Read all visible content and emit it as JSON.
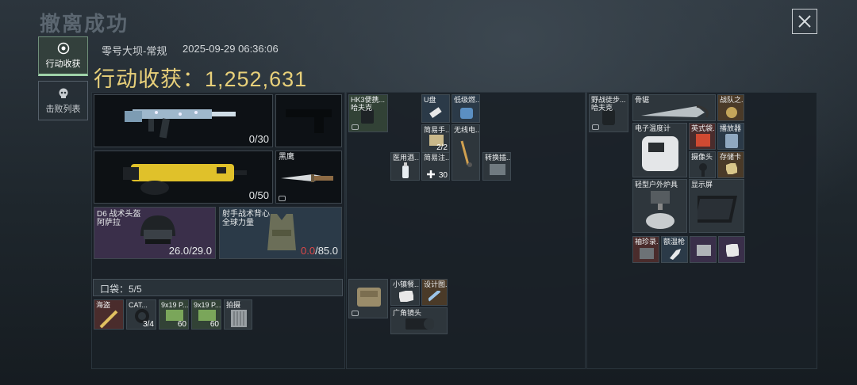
{
  "header": {
    "title": "撤离成功",
    "map": "零号大坝-常规",
    "datetime": "2025-09-29 06:36:06",
    "harvest_label": "行动收获：",
    "harvest_value": "1,252,631"
  },
  "sidebar": {
    "items": [
      {
        "label": "行动收获"
      },
      {
        "label": "击败列表"
      }
    ]
  },
  "loadout": {
    "weapon1": {
      "ammo": "0/30"
    },
    "weapon2": {
      "ammo": "0/50"
    },
    "melee": {
      "label": "黑鹰"
    },
    "helmet": {
      "name": "D6 战术头盔",
      "sub": "阿萨拉",
      "durability": "26.0/29.0"
    },
    "armor": {
      "name": "射手战术背心",
      "sub": "全球力量",
      "durability_current": "0.0",
      "durability_max": "/85.0"
    },
    "pocket_label": "口袋：5/5"
  },
  "pocket_items": [
    {
      "name": "海盗",
      "count": ""
    },
    {
      "name": "CAT...",
      "count": "3/4"
    },
    {
      "name": "9x19 P...",
      "count": "60"
    },
    {
      "name": "9x19 P...",
      "count": "60"
    },
    {
      "name": "拍摄",
      "count": ""
    }
  ],
  "bag_items": {
    "hk": "HK3便携...",
    "hk_sub": "哈夫克",
    "u": "U盘",
    "low": "低级燃...",
    "simple1": "简易手...",
    "simple1_count": "2/2",
    "radio": "无线电...",
    "med": "医用酒...",
    "simple2": "简易注...",
    "simple2_count": "30",
    "conv": "转换插...",
    "small": "小镇餐...",
    "design": "设计图...",
    "lens": "广角镜头"
  },
  "backpack": {
    "name": "野战徒步...",
    "sub": "哈夫克"
  },
  "container_items": {
    "saw": "骨锯",
    "battle": "战队之...",
    "thermo": "电子温度计",
    "english": "英式袋...",
    "player": "播放器",
    "camera": "摄像头",
    "card": "存储卡",
    "stove": "轻型户外炉具",
    "screen": "显示屏",
    "cuff": "袖珍录...",
    "thermo2": "额温枪"
  },
  "colors": {
    "accent": "#e8d07a",
    "danger": "#e04848",
    "green_tag": "#9fd3a9"
  }
}
